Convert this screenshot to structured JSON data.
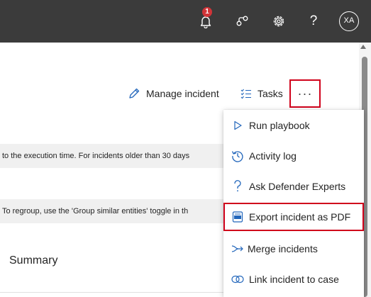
{
  "topbar": {
    "notification_count": "1",
    "help_glyph": "?",
    "avatar_initials": "XA",
    "icons": [
      "bell-icon",
      "share-icon",
      "gear-icon",
      "help-icon"
    ]
  },
  "command_bar": {
    "manage_incident_label": "Manage incident",
    "tasks_label": "Tasks",
    "more_label": "···"
  },
  "info_bars": [
    "to the execution time. For incidents older than 30 days",
    "To regroup, use the 'Group similar entities' toggle in th"
  ],
  "summary_label": "Summary",
  "menu": {
    "items": [
      {
        "label": "Run playbook",
        "icon": "play-icon"
      },
      {
        "label": "Activity log",
        "icon": "history-icon"
      },
      {
        "label": "Ask Defender Experts",
        "icon": "question-icon"
      },
      {
        "label": "Export incident as PDF",
        "icon": "pdf-icon"
      },
      {
        "label": "Merge incidents",
        "icon": "merge-icon"
      },
      {
        "label": "Link incident to case",
        "icon": "link-icon"
      }
    ]
  },
  "colors": {
    "topbar_bg": "#3b3b3b",
    "accent": "#2266bb",
    "highlight_red": "#d0021b",
    "badge_red": "#d13438"
  }
}
